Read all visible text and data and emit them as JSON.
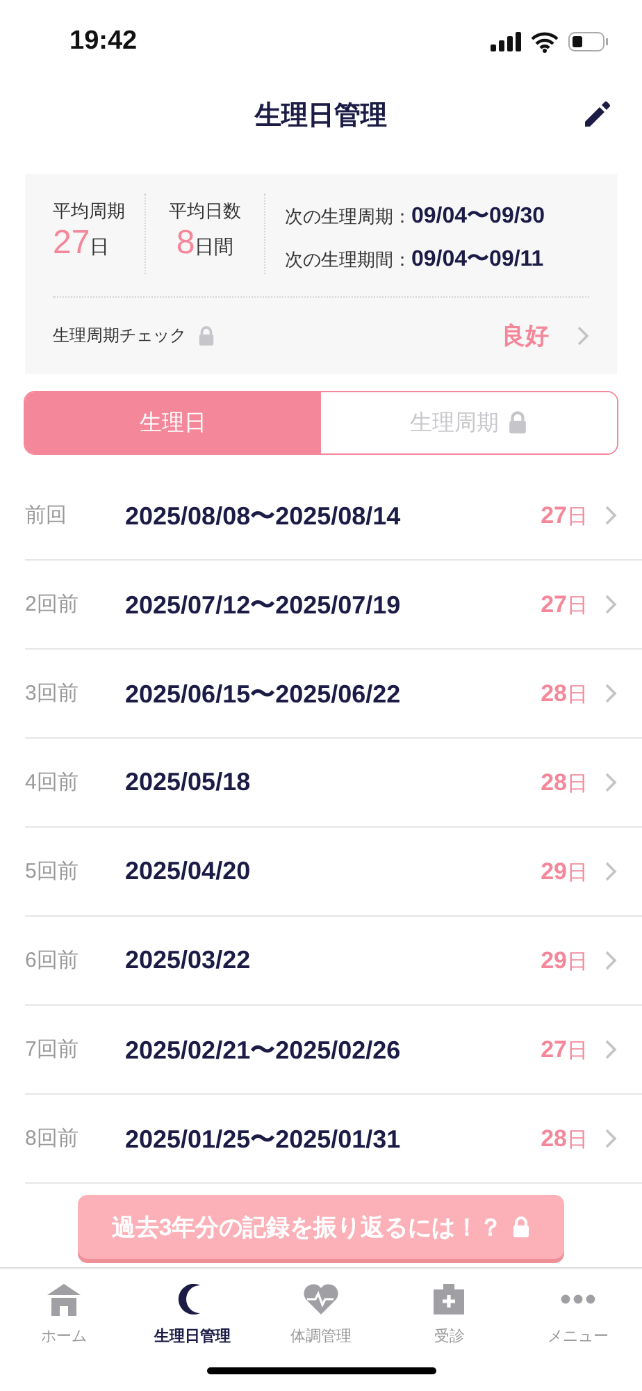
{
  "status_bar": {
    "time": "19:42"
  },
  "header": {
    "title": "生理日管理"
  },
  "summary": {
    "stats": [
      {
        "label": "平均周期",
        "value": "27",
        "unit": "日"
      },
      {
        "label": "平均日数",
        "value": "8",
        "unit": "日間"
      }
    ],
    "next": [
      {
        "label": "次の生理周期：",
        "value": "09/04〜09/30"
      },
      {
        "label": "次の生理期間：",
        "value": "09/04〜09/11"
      }
    ],
    "check": {
      "label": "生理周期チェック",
      "locked": true,
      "result": "良好"
    }
  },
  "tabs": [
    {
      "label": "生理日",
      "selected": true,
      "locked": false
    },
    {
      "label": "生理周期",
      "selected": false,
      "locked": true
    }
  ],
  "records": [
    {
      "label": "前回",
      "dates": "2025/08/08〜2025/08/14",
      "days": "27",
      "unit": "日"
    },
    {
      "label": "2回前",
      "dates": "2025/07/12〜2025/07/19",
      "days": "27",
      "unit": "日"
    },
    {
      "label": "3回前",
      "dates": "2025/06/15〜2025/06/22",
      "days": "28",
      "unit": "日"
    },
    {
      "label": "4回前",
      "dates": "2025/05/18",
      "days": "28",
      "unit": "日"
    },
    {
      "label": "5回前",
      "dates": "2025/04/20",
      "days": "29",
      "unit": "日"
    },
    {
      "label": "6回前",
      "dates": "2025/03/22",
      "days": "29",
      "unit": "日"
    },
    {
      "label": "7回前",
      "dates": "2025/02/21〜2025/02/26",
      "days": "27",
      "unit": "日"
    },
    {
      "label": "8回前",
      "dates": "2025/01/25〜2025/01/31",
      "days": "28",
      "unit": "日"
    }
  ],
  "banner": {
    "text": "過去3年分の記録を振り返るには！？",
    "locked": true
  },
  "nav": [
    {
      "label": "ホーム",
      "kind": "home",
      "selected": false
    },
    {
      "label": "生理日管理",
      "kind": "moon",
      "selected": true
    },
    {
      "label": "体調管理",
      "kind": "heart",
      "selected": false
    },
    {
      "label": "受診",
      "kind": "clinic",
      "selected": false
    },
    {
      "label": "メニュー",
      "kind": "more",
      "selected": false
    }
  ]
}
